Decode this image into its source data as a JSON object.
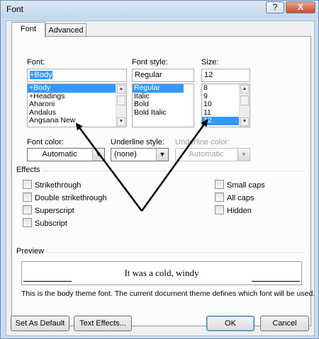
{
  "window": {
    "title": "Font",
    "help_glyph": "?",
    "close_glyph": "X"
  },
  "tabs": [
    {
      "label": "Font"
    },
    {
      "label": "Advanced"
    }
  ],
  "font": {
    "label": "Font:",
    "value": "+Body",
    "items": [
      "+Body",
      "+Headings",
      "Aharoni",
      "Andalus",
      "Angsana New"
    ],
    "selected_index": 0
  },
  "font_style": {
    "label": "Font style:",
    "value": "Regular",
    "items": [
      "Regular",
      "Italic",
      "Bold",
      "Bold Italic"
    ],
    "selected_index": 0
  },
  "size": {
    "label": "Size:",
    "value": "12",
    "items": [
      "8",
      "9",
      "10",
      "11",
      "12"
    ],
    "selected_index": 4
  },
  "font_color": {
    "label": "Font color:",
    "value": "Automatic"
  },
  "underline_style": {
    "label": "Underline style:",
    "value": "(none)"
  },
  "underline_color": {
    "label": "Underline color:",
    "value": "Automatic",
    "disabled": true
  },
  "effects": {
    "label": "Effects",
    "left": [
      "Strikethrough",
      "Double strikethrough",
      "Superscript",
      "Subscript"
    ],
    "right": [
      "Small caps",
      "All caps",
      "Hidden"
    ]
  },
  "preview": {
    "label": "Preview",
    "sample_text": "It was a cold, windy",
    "description": "This is the body theme font. The current document theme defines which font will be used."
  },
  "buttons": {
    "set_default": "Set As Default",
    "text_effects": "Text Effects...",
    "ok": "OK",
    "cancel": "Cancel"
  },
  "colors": {
    "selection": "#3399ff",
    "title_bar": "#c9dcf0",
    "close_button": "#c94a2c"
  }
}
